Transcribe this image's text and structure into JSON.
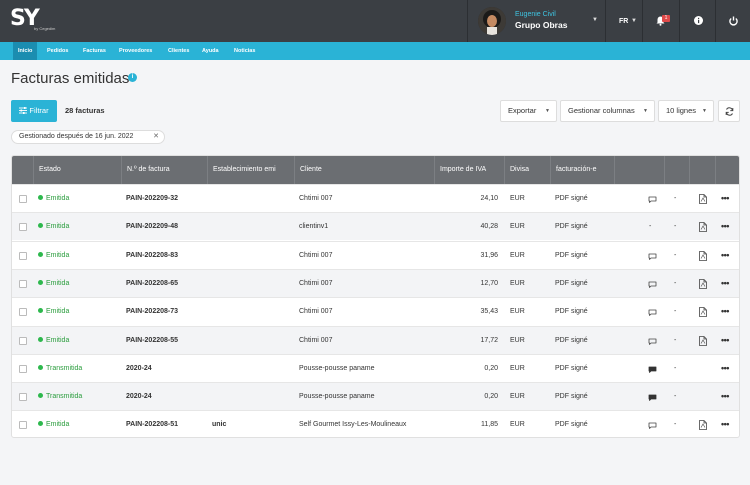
{
  "header": {
    "logo_text": "SY",
    "logo_by": "by Cegedim",
    "user_name": "Eugenie Civil",
    "company": "Grupo Obras",
    "language": "FR",
    "notif_count": "1",
    "icons": [
      "bell-icon",
      "info-icon",
      "power-icon"
    ]
  },
  "nav": [
    "Inicio",
    "Pedidos",
    "Facturas",
    "Proveedores",
    "Clientes",
    "Ayuda",
    "Noticias"
  ],
  "page": {
    "title": "Facturas emitidas",
    "filter_label": "Filtrar",
    "count": "28 facturas",
    "export_label": "Exportar",
    "columns_label": "Gestionar columnas",
    "lines_label": "10 lignes",
    "chip": "Gestionado después de 16 jun. 2022"
  },
  "table": {
    "headers": [
      "Estado",
      "N.º de factura",
      "Establecimiento emi",
      "Cliente",
      "Importe de IVA",
      "Divisa",
      "facturación-e"
    ],
    "rows": [
      {
        "status": "Emitida",
        "number": "PAIN-202209-32",
        "establishment": "",
        "client": "Chtimi 007",
        "vat": "24,10",
        "currency": "EUR",
        "einvoice": "PDF signé",
        "comment": "comment-icon",
        "dash": "-",
        "pdf": true
      },
      {
        "status": "Emitida",
        "number": "PAIN-202209-48",
        "establishment": "",
        "client": "clientinv1",
        "vat": "40,28",
        "currency": "EUR",
        "einvoice": "PDF signé",
        "comment": "-",
        "dash": "-",
        "pdf": true
      },
      {
        "status": "Emitida",
        "number": "PAIN-202208-83",
        "establishment": "",
        "client": "Chtimi 007",
        "vat": "31,96",
        "currency": "EUR",
        "einvoice": "PDF signé",
        "comment": "comment-icon",
        "dash": "-",
        "pdf": true
      },
      {
        "status": "Emitida",
        "number": "PAIN-202208-65",
        "establishment": "",
        "client": "Chtimi 007",
        "vat": "12,70",
        "currency": "EUR",
        "einvoice": "PDF signé",
        "comment": "comment-icon",
        "dash": "-",
        "pdf": true
      },
      {
        "status": "Emitida",
        "number": "PAIN-202208-73",
        "establishment": "",
        "client": "Chtimi 007",
        "vat": "35,43",
        "currency": "EUR",
        "einvoice": "PDF signé",
        "comment": "comment-icon",
        "dash": "-",
        "pdf": true
      },
      {
        "status": "Emitida",
        "number": "PAIN-202208-55",
        "establishment": "",
        "client": "Chtimi 007",
        "vat": "17,72",
        "currency": "EUR",
        "einvoice": "PDF signé",
        "comment": "comment-icon",
        "dash": "-",
        "pdf": true
      },
      {
        "status": "Transmitida",
        "number": "2020-24",
        "establishment": "",
        "client": "Pousse-pousse paname",
        "vat": "0,20",
        "currency": "EUR",
        "einvoice": "PDF signé",
        "comment": "comment-filled-icon",
        "dash": "-",
        "pdf": false
      },
      {
        "status": "Transmitida",
        "number": "2020-24",
        "establishment": "",
        "client": "Pousse-pousse paname",
        "vat": "0,20",
        "currency": "EUR",
        "einvoice": "PDF signé",
        "comment": "comment-filled-icon",
        "dash": "-",
        "pdf": false
      },
      {
        "status": "Emitida",
        "number": "PAIN-202208-51",
        "establishment": "unic",
        "client": "Self Gourmet Issy-Les-Moulineaux",
        "vat": "11,85",
        "currency": "EUR",
        "einvoice": "PDF signé",
        "comment": "comment-icon",
        "dash": "-",
        "pdf": true
      }
    ]
  },
  "colors": {
    "accent": "#2ab3d6",
    "header_bg": "#3b3f44",
    "status_green": "#2db84d",
    "table_header": "#6b6e72"
  }
}
